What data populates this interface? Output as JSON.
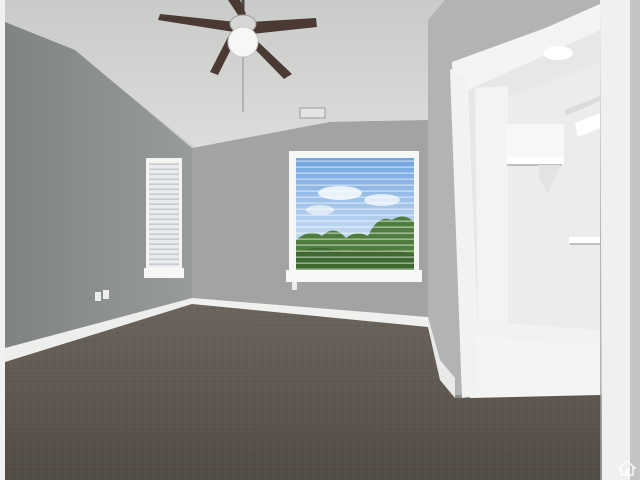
{
  "scene": {
    "subject": "empty-bedroom-with-walk-in-closet"
  },
  "colors": {
    "ceiling": "#d9dad8",
    "wall_left": "#8c8f8f",
    "wall_back": "#a3a5a4",
    "wall_right": "#b3b5b4",
    "trim": "#f2f2f0",
    "carpet": "#5c5650",
    "carpet_far": "#6e6962",
    "closet_wall": "#e7e8e7",
    "fan_blade": "#4b3a33",
    "sky": "#8fb8e6",
    "trees": "#4f7d3d"
  },
  "watermark": {
    "icon": "house-icon"
  }
}
